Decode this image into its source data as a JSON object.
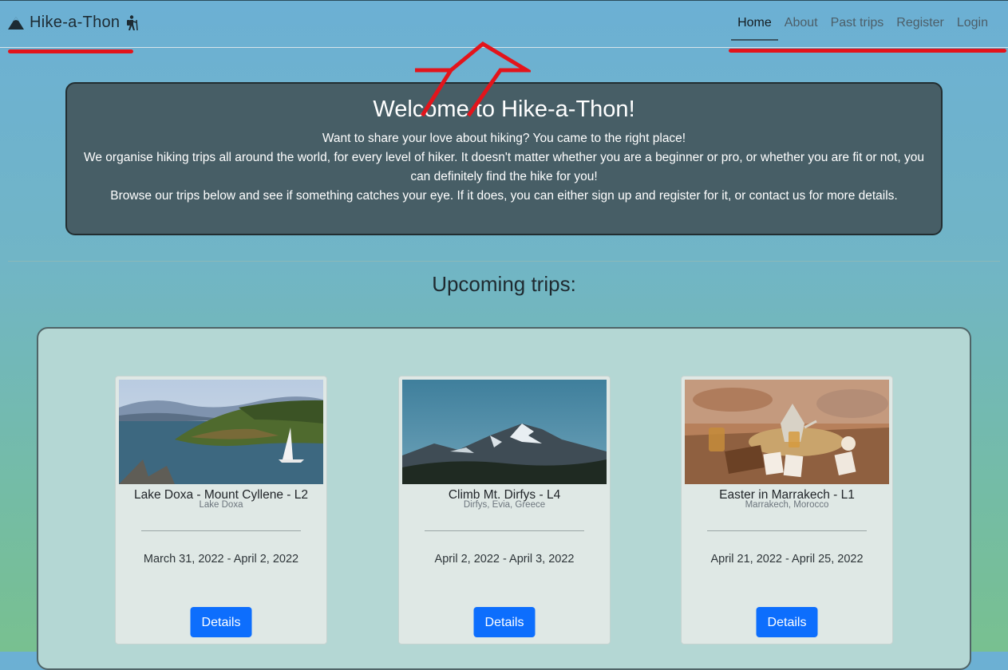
{
  "brand": {
    "name": "Hike-a-Thon",
    "icons": [
      "mountain-icon",
      "hiker-icon"
    ]
  },
  "nav": {
    "items": [
      {
        "label": "Home",
        "active": true
      },
      {
        "label": "About"
      },
      {
        "label": "Past trips"
      },
      {
        "label": "Register"
      },
      {
        "label": "Login"
      }
    ]
  },
  "hero": {
    "title": "Welcome to Hike-a-Thon!",
    "line1": "Want to share your love about hiking? You came to the right place!",
    "line2": "We organise hiking trips all around the world, for every level of hiker. It doesn't matter whether you are a beginner or pro, or whether you are fit or not, you can definitely find the hike for you!",
    "line3": "Browse our trips below and see if something catches your eye. If it does, you can either sign up and register for it, or contact us for more details."
  },
  "section_title": "Upcoming trips:",
  "trips": [
    {
      "title": "Lake Doxa - Mount Cyllene - L2",
      "location": "Lake Doxa",
      "dates": "March 31, 2022 - April 2, 2022",
      "button": "Details"
    },
    {
      "title": "Climb Mt. Dirfys - L4",
      "location": "Dirfys, Evia, Greece",
      "dates": "April 2, 2022 - April 3, 2022",
      "button": "Details"
    },
    {
      "title": "Easter in Marrakech - L1",
      "location": "Marrakech, Morocco",
      "dates": "April 21, 2022 - April 25, 2022",
      "button": "Details"
    }
  ],
  "colors": {
    "annotation_red": "#e3141b",
    "hero_bg": "#475e66",
    "button_blue": "#0d6efd"
  }
}
